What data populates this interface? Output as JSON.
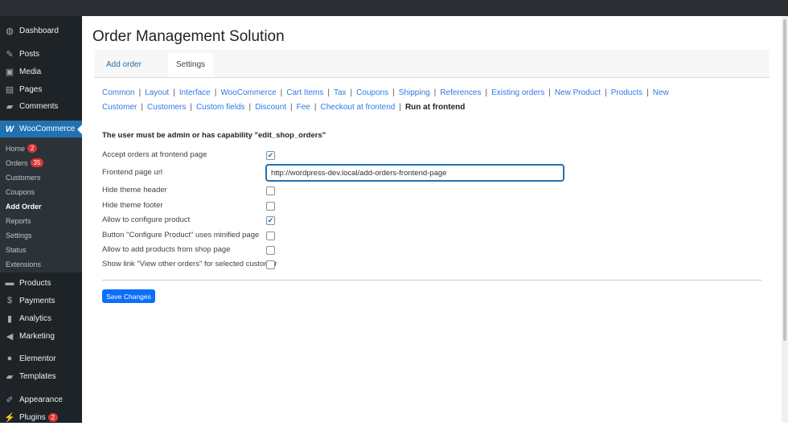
{
  "sidebar": {
    "top": [
      {
        "label": "Dashboard",
        "icon": "dashboard-icon"
      },
      {
        "label": "Posts",
        "icon": "pin-icon"
      },
      {
        "label": "Media",
        "icon": "media-icon"
      },
      {
        "label": "Pages",
        "icon": "pages-icon"
      },
      {
        "label": "Comments",
        "icon": "comment-icon"
      }
    ],
    "woocommerce": "WooCommerce",
    "sub": [
      {
        "label": "Home",
        "badge": "2"
      },
      {
        "label": "Orders",
        "badge": "35"
      },
      {
        "label": "Customers"
      },
      {
        "label": "Coupons"
      },
      {
        "label": "Add Order",
        "current": true
      },
      {
        "label": "Reports"
      },
      {
        "label": "Settings"
      },
      {
        "label": "Status"
      },
      {
        "label": "Extensions"
      }
    ],
    "bottom": [
      {
        "label": "Products",
        "icon": "archive-icon"
      },
      {
        "label": "Payments",
        "icon": "money-icon"
      },
      {
        "label": "Analytics",
        "icon": "chart-bar-icon"
      },
      {
        "label": "Marketing",
        "icon": "megaphone-icon"
      },
      {
        "label": "Elementor",
        "icon": "elementor-icon"
      },
      {
        "label": "Templates",
        "icon": "folder-icon"
      },
      {
        "label": "Appearance",
        "icon": "brush-icon"
      },
      {
        "label": "Plugins",
        "icon": "plugin-icon",
        "badge": "2"
      }
    ]
  },
  "page_title": "Order Management Solution",
  "tabs": [
    {
      "label": "Add order"
    },
    {
      "label": "Settings",
      "active": true
    }
  ],
  "sections": [
    "Common",
    "Layout",
    "Interface",
    "WooCommerce",
    "Cart Items",
    "Tax",
    "Coupons",
    "Shipping",
    "References",
    "Existing orders",
    "New Product",
    "Products",
    "New Customer",
    "Customers",
    "Custom fields",
    "Discount",
    "Fee",
    "Checkout at frontend",
    "Run at frontend"
  ],
  "active_section": "Run at frontend",
  "note": "The user must be admin or has capability \"edit_shop_orders\"",
  "settings": {
    "accept": {
      "label": "Accept orders at frontend page",
      "checked": true
    },
    "url": {
      "label": "Frontend page url",
      "value": "http://wordpress-dev.local/add-orders-frontend-page"
    },
    "hide_header": {
      "label": "Hide theme header",
      "checked": false
    },
    "hide_footer": {
      "label": "Hide theme footer",
      "checked": false
    },
    "configure": {
      "label": "Allow to configure product",
      "checked": true
    },
    "minified": {
      "label": "Button \"Configure Product\" uses minified page",
      "checked": false
    },
    "shop": {
      "label": "Allow to add products from shop page",
      "checked": false
    },
    "view_other": {
      "label": "Show link \"View other orders\" for selected customer",
      "checked": false
    }
  },
  "save_label": "Save Changes",
  "colors": {
    "accent": "#2271b1",
    "button": "#0d6efd",
    "badge": "#d63638"
  }
}
